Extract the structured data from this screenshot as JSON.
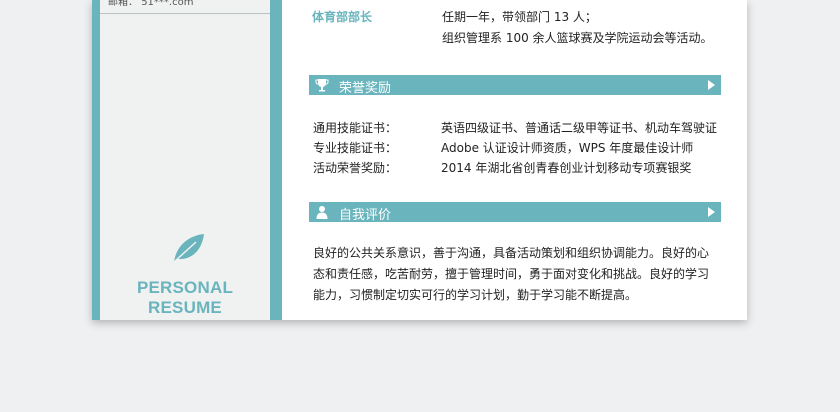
{
  "sidebar": {
    "email_label": "邮箱：",
    "email_value": "51***.com",
    "resume_title": "PERSONAL RESUME",
    "accent": "#6ab5bd"
  },
  "experience": {
    "role": "体育部部长",
    "lines": [
      "任期一年，带领部门 13 人；",
      "组织管理系 100 余人篮球赛及学院运动会等活动。"
    ]
  },
  "awards": {
    "title": "荣誉奖励",
    "icon": "trophy-icon",
    "items": [
      {
        "label": "通用技能证书：",
        "value": "英语四级证书、普通话二级甲等证书、机动车驾驶证"
      },
      {
        "label": "专业技能证书：",
        "value": "Adobe 认证设计师资质，WPS 年度最佳设计师"
      },
      {
        "label": "活动荣誉奖励：",
        "value": "2014 年湖北省创青春创业计划移动专项赛银奖"
      }
    ]
  },
  "self_eval": {
    "title": "自我评价",
    "icon": "person-icon",
    "text": "良好的公共关系意识，善于沟通，具备活动策划和组织协调能力。良好的心态和责任感，吃苦耐劳，擅于管理时间，勇于面对变化和挑战。良好的学习能力，习惯制定切实可行的学习计划，勤于学习能不断提高。"
  }
}
